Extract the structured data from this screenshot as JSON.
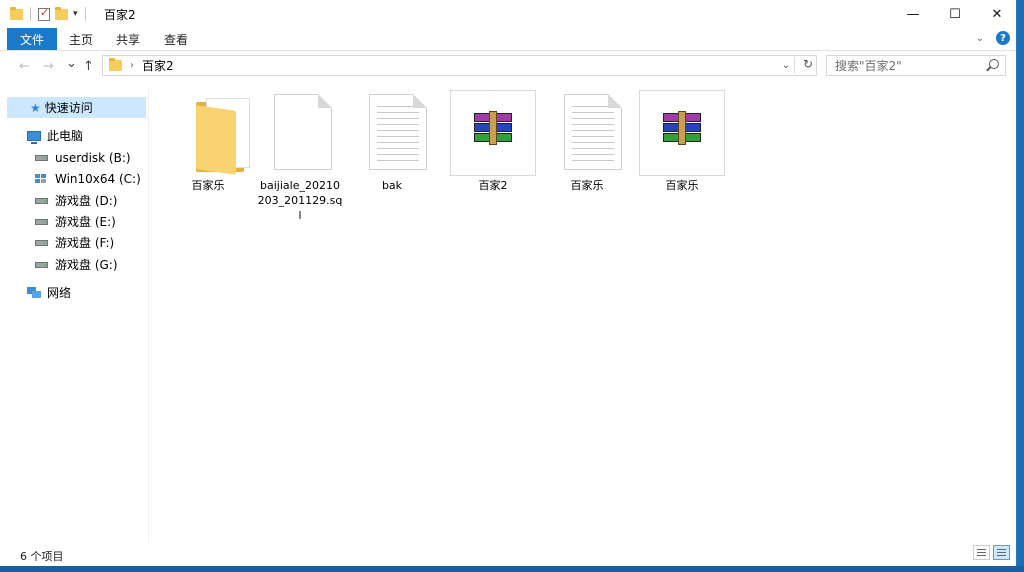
{
  "window": {
    "title": "百家2",
    "controls": {
      "minimize": "—",
      "maximize": "☐",
      "close": "✕"
    }
  },
  "ribbon": {
    "tabs": [
      "文件",
      "主页",
      "共享",
      "查看"
    ],
    "expand_icon": "chevron-down-icon",
    "help_label": "?"
  },
  "nav": {
    "back": "←",
    "forward": "→",
    "recent": "⌄",
    "up": "↑"
  },
  "address": {
    "path": "百家2",
    "separator": "›"
  },
  "search": {
    "placeholder": "搜索\"百家2\""
  },
  "sidebar": {
    "items": [
      {
        "label": "快速访问",
        "icon": "star-icon"
      },
      {
        "label": "此电脑",
        "icon": "computer-icon"
      },
      {
        "label": "userdisk (B:)",
        "icon": "drive-icon"
      },
      {
        "label": "Win10x64 (C:)",
        "icon": "windows-drive-icon"
      },
      {
        "label": "游戏盘 (D:)",
        "icon": "drive-icon"
      },
      {
        "label": "游戏盘 (E:)",
        "icon": "drive-icon"
      },
      {
        "label": "游戏盘 (F:)",
        "icon": "drive-icon"
      },
      {
        "label": "游戏盘 (G:)",
        "icon": "drive-icon"
      },
      {
        "label": "网络",
        "icon": "network-icon"
      }
    ]
  },
  "files": [
    {
      "name": "百家乐",
      "type": "folder",
      "icon": "folder-icon"
    },
    {
      "name": "baijiale_20210203_201129.sql",
      "type": "file",
      "icon": "blank-file-icon"
    },
    {
      "name": "bak",
      "type": "file",
      "icon": "text-file-icon"
    },
    {
      "name": "百家2",
      "type": "archive",
      "icon": "winrar-archive-icon"
    },
    {
      "name": "百家乐",
      "type": "file",
      "icon": "text-file-icon"
    },
    {
      "name": "百家乐",
      "type": "archive",
      "icon": "winrar-archive-icon"
    }
  ],
  "status": {
    "item_count": "6 个项目"
  },
  "colors": {
    "accent": "#1979ca",
    "selection": "#cce8ff",
    "folder": "#f8d36f"
  }
}
